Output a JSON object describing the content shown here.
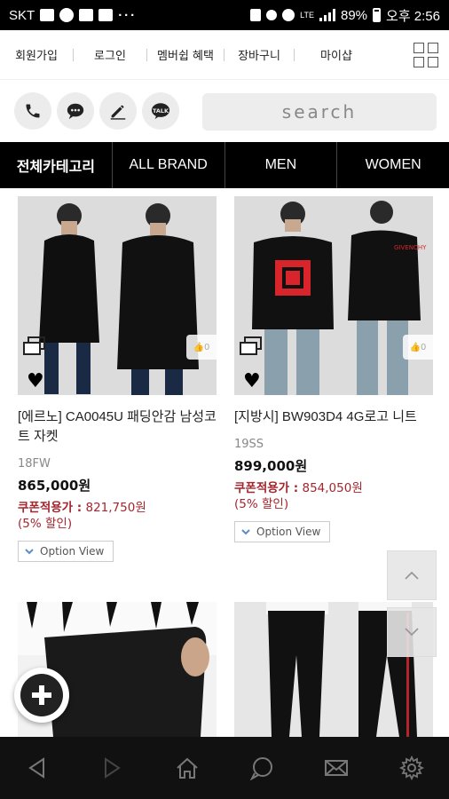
{
  "status_bar": {
    "carrier": "SKT",
    "network": "LTE",
    "battery": "89%",
    "time": "오후 2:56"
  },
  "top_nav": {
    "items": [
      {
        "label": "회원가입"
      },
      {
        "label": "로그인"
      },
      {
        "label": "멤버쉽 혜택"
      },
      {
        "label": "장바구니"
      },
      {
        "label": "마이샵"
      }
    ]
  },
  "search": {
    "placeholder": "search"
  },
  "categories": [
    {
      "label": "전체카테고리"
    },
    {
      "label": "ALL BRAND"
    },
    {
      "label": "MEN"
    },
    {
      "label": "WOMEN"
    }
  ],
  "products": [
    {
      "title": "[에르노] CA0045U 패딩안감 남성코트 자켓",
      "season": "18FW",
      "price": "865,000원",
      "coupon_label": "쿠폰적용가 :",
      "coupon_price": "821,750원",
      "discount": "(5% 할인)",
      "option_label": "Option View",
      "like_count": "0"
    },
    {
      "title": "[지방시] BW903D4 4G로고 니트",
      "season": "19SS",
      "price": "899,000원",
      "coupon_label": "쿠폰적용가 :",
      "coupon_price": "854,050원",
      "discount": "(5% 할인)",
      "option_label": "Option View",
      "like_count": "0"
    }
  ],
  "colors": {
    "accent_red": "#a3262e",
    "category_bar": "#000000",
    "bottom_nav": "#111111"
  },
  "icons": [
    "phone-icon",
    "chat-icon",
    "pencil-icon",
    "talk-icon",
    "grid-menu-icon",
    "heart-icon",
    "copy-icon",
    "like-icon",
    "chevron-up-icon",
    "chevron-down-icon",
    "plus-icon",
    "back-icon",
    "forward-icon",
    "home-icon",
    "message-icon",
    "mail-icon",
    "settings-icon"
  ]
}
